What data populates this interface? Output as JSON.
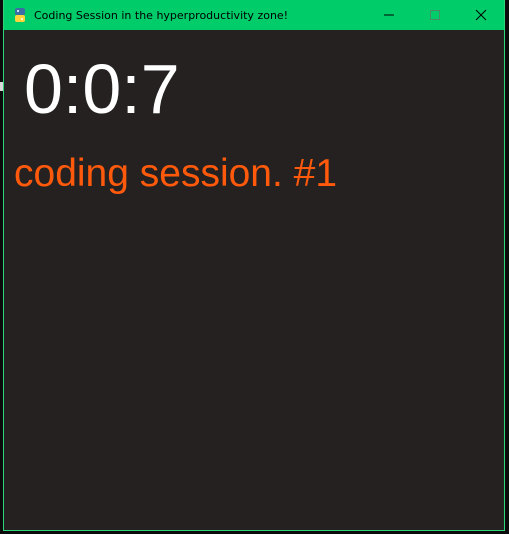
{
  "window": {
    "title": "Coding Session in the hyperproductivity zone!",
    "titlebar_color": "#00cc6a",
    "background_color": "#252121"
  },
  "icons": {
    "app": "python-snake-icon",
    "minimize": "minimize-icon",
    "maximize": "maximize-icon",
    "close": "close-icon"
  },
  "main": {
    "timer": "0:0:7",
    "timer_color": "#ffffff",
    "session_label": "coding session. #1",
    "session_color": "#ff5a0c"
  }
}
